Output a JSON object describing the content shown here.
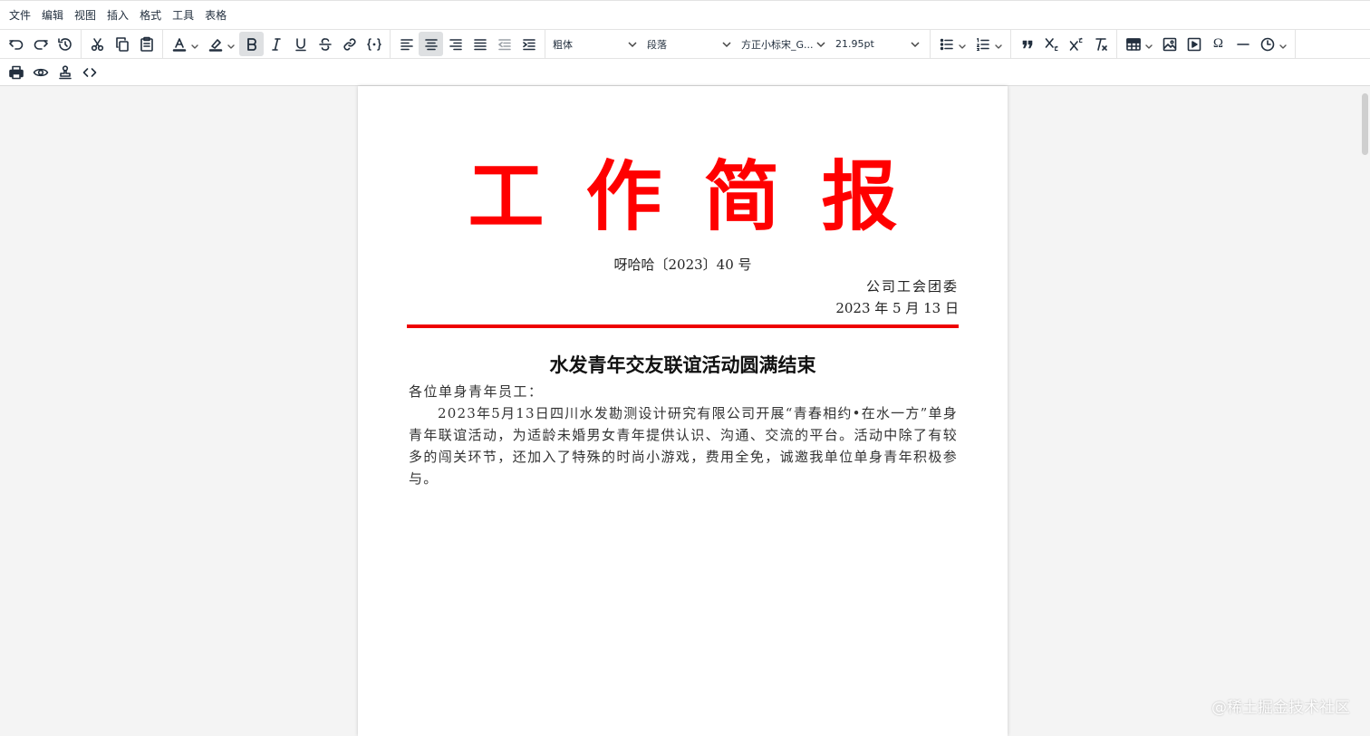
{
  "menubar": {
    "items": [
      "文件",
      "编辑",
      "视图",
      "插入",
      "格式",
      "工具",
      "表格"
    ]
  },
  "toolbar": {
    "font_weight": "粗体",
    "block_format": "段落",
    "font_family": "方正小标宋_G...",
    "font_size": "21.95pt",
    "active_buttons": [
      "bold",
      "align-center"
    ],
    "icons_row1": [
      "undo-icon",
      "redo-icon",
      "history-icon",
      "cut-icon",
      "copy-icon",
      "paste-icon",
      "text-color-icon",
      "highlight-color-icon",
      "bold-icon",
      "italic-icon",
      "underline-icon",
      "strikethrough-icon",
      "link-icon",
      "code-braces-icon",
      "align-left-icon",
      "align-center-icon",
      "align-right-icon",
      "align-justify-icon",
      "outdent-icon",
      "indent-icon",
      "bullet-list-icon",
      "numbered-list-icon",
      "blockquote-icon",
      "subscript-icon",
      "superscript-icon",
      "clear-format-icon",
      "table-icon",
      "image-icon",
      "media-icon",
      "special-char-icon",
      "horizontal-rule-icon",
      "datetime-icon"
    ],
    "icons_row2": [
      "print-icon",
      "preview-icon",
      "stamp-icon",
      "source-code-icon"
    ]
  },
  "document": {
    "red_title": "工作简报",
    "doc_number": "呀哈哈〔2023〕40 号",
    "issuer": "公司工会团委",
    "date": "2023 年  5 月  13 日",
    "headline": "水发青年交友联谊活动圆满结束",
    "salutation": "各位单身青年员工：",
    "body": "2023年5月13日四川水发勘测设计研究有限公司开展“青春相约•在水一方”单身青年联谊活动，为适龄未婚男女青年提供认识、沟通、交流的平台。活动中除了有较多的闯关环节，还加入了特殊的时尚小游戏，费用全免，诚邀我单位单身青年积极参与。"
  },
  "watermark": "@稀土掘金技术社区",
  "colors": {
    "title_red": "#ff0000",
    "rule_red": "#ee0000",
    "active_button_bg": "#dee0e2"
  }
}
